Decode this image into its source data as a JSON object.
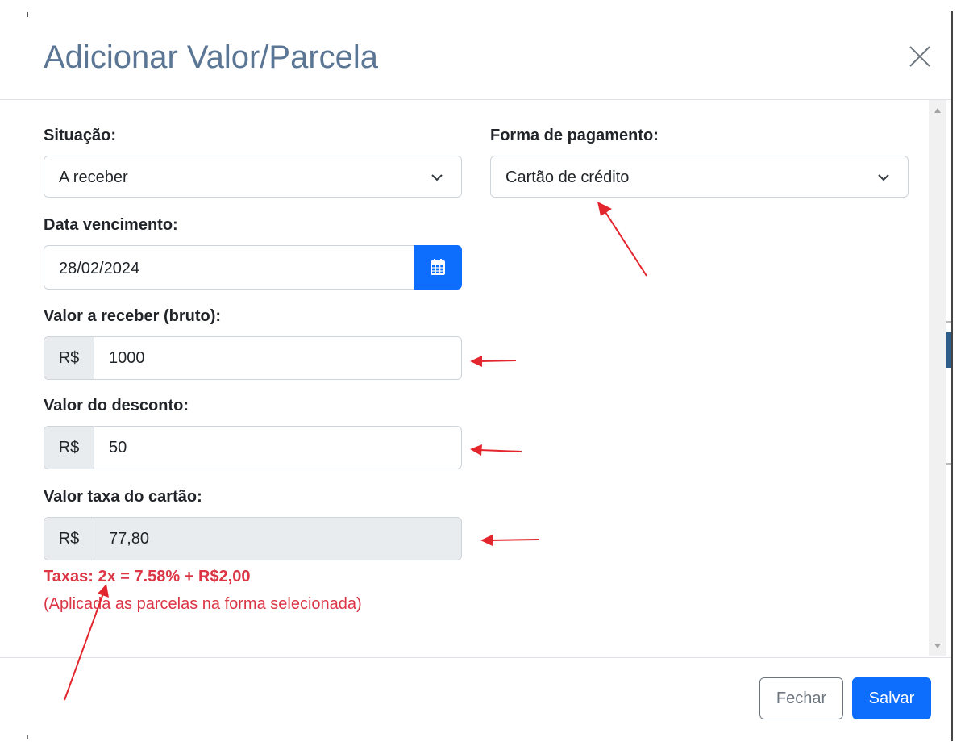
{
  "modal": {
    "title": "Adicionar Valor/Parcela",
    "close_icon": "close-icon"
  },
  "form": {
    "situacao": {
      "label": "Situação:",
      "value": "A receber"
    },
    "forma_pagamento": {
      "label": "Forma de pagamento:",
      "value": "Cartão de crédito"
    },
    "data_vencimento": {
      "label": "Data vencimento:",
      "value": "28/02/2024",
      "button_icon": "calendar-icon"
    },
    "valor_bruto": {
      "label": "Valor a receber (bruto):",
      "prefix": "R$",
      "value": "1000"
    },
    "valor_desconto": {
      "label": "Valor do desconto:",
      "prefix": "R$",
      "value": "50"
    },
    "valor_taxa": {
      "label": "Valor taxa do cartão:",
      "prefix": "R$",
      "value": "77,80"
    },
    "taxas_info": "Taxas: 2x = 7.58% + R$2,00",
    "taxas_note": "(Aplicada as parcelas na forma selecionada)"
  },
  "footer": {
    "close_label": "Fechar",
    "save_label": "Salvar"
  },
  "colors": {
    "title": "#5b7694",
    "primary": "#0d6efd",
    "danger": "#dc3545",
    "annotation_arrow": "#e3262d"
  }
}
